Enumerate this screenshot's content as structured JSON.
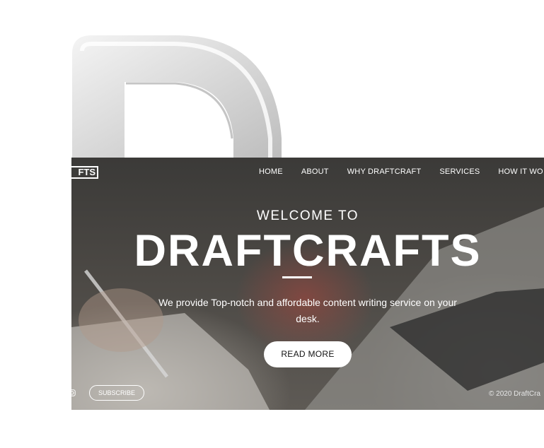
{
  "brand": {
    "logo_text": "FTS",
    "logo_letter": "D"
  },
  "nav": {
    "items": [
      "HOME",
      "ABOUT",
      "WHY DRAFTCRAFT",
      "SERVICES",
      "HOW IT WO"
    ]
  },
  "hero": {
    "kicker": "WELCOME TO",
    "title": "DRAFTCRAFTS",
    "tagline": "We provide Top-notch and affordable content writing service on your desk.",
    "cta": "READ MORE"
  },
  "footer": {
    "subscribe": "SUBSCRIBE",
    "copyright": "© 2020 DraftCra"
  },
  "colors": {
    "overlay": "#3b3a38",
    "text": "#ffffff",
    "button": "#ffffff"
  },
  "icons": [
    "instagram-icon"
  ]
}
